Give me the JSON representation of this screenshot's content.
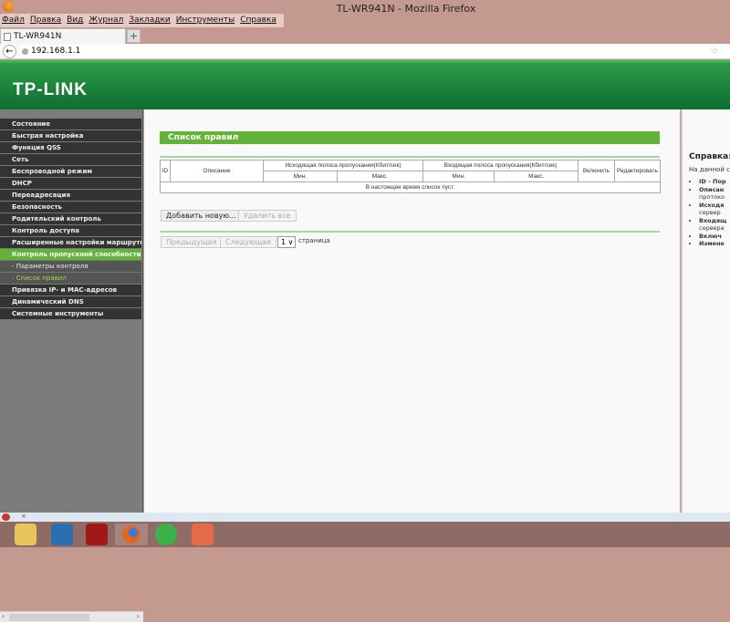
{
  "window": {
    "title": "TL-WR941N - Mozilla Firefox"
  },
  "menu": [
    "Файл",
    "Правка",
    "Вид",
    "Журнал",
    "Закладки",
    "Инструменты",
    "Справка"
  ],
  "tab": {
    "label": "TL-WR941N",
    "new_tab": "+"
  },
  "address": {
    "url": "192.168.1.1"
  },
  "brand": {
    "logo": "TP-LINK",
    "accent": "#62b338",
    "header": "#1a7f38"
  },
  "sidebar": {
    "items": [
      {
        "label": "Состояние"
      },
      {
        "label": "Быстрая настройка"
      },
      {
        "label": "Функция QSS"
      },
      {
        "label": "Сеть"
      },
      {
        "label": "Беспроводной режим"
      },
      {
        "label": "DHCP"
      },
      {
        "label": "Переадресация"
      },
      {
        "label": "Безопасность"
      },
      {
        "label": "Родительский контроль"
      },
      {
        "label": "Контроль доступа"
      },
      {
        "label": "Расширенные настройки маршрутизации"
      },
      {
        "label": "Контроль пропускной способности",
        "active": true
      },
      {
        "label": "- Параметры контроля",
        "sub": true
      },
      {
        "label": "- Список правил",
        "sub": true,
        "current": true
      },
      {
        "label": "Привязка IP- и MAC-адресов"
      },
      {
        "label": "Динамический DNS"
      },
      {
        "label": "Системные инструменты"
      }
    ]
  },
  "main": {
    "section_title": "Список правил",
    "table": {
      "headers": {
        "id": "ID",
        "description": "Описание",
        "egress": "Исходящая полоса пропускания(Кбит/сек)",
        "ingress": "Входящая полоса пропускания(Кбит/сек)",
        "enable": "Включить",
        "edit": "Редактировать",
        "min": "Мин.",
        "max": "Макс."
      },
      "empty": "В настоящее время список пуст."
    },
    "add_button": "Добавить новую...",
    "delete_all_button": "Удалить все",
    "prev_button": "Предыдущая",
    "next_button": "Следующая",
    "page_select": "1 ∨",
    "page_label": "страница"
  },
  "help": {
    "title": "Справка: С",
    "intro": "На данной стр",
    "items": [
      {
        "bold": "ID - Пор",
        "rest": ""
      },
      {
        "bold": "Описан",
        "rest": "протоко"
      },
      {
        "bold": "Исходя",
        "rest": "сервер"
      },
      {
        "bold": "Входящ",
        "rest": "сервера"
      },
      {
        "bold": "Включ",
        "rest": ""
      },
      {
        "bold": "Измене",
        "rest": ""
      }
    ]
  },
  "taskbar": {
    "icons": [
      "file-explorer-icon",
      "control-panel-icon",
      "power-icon",
      "firefox-icon",
      "mail-agent-icon",
      "powerpoint-icon"
    ]
  }
}
